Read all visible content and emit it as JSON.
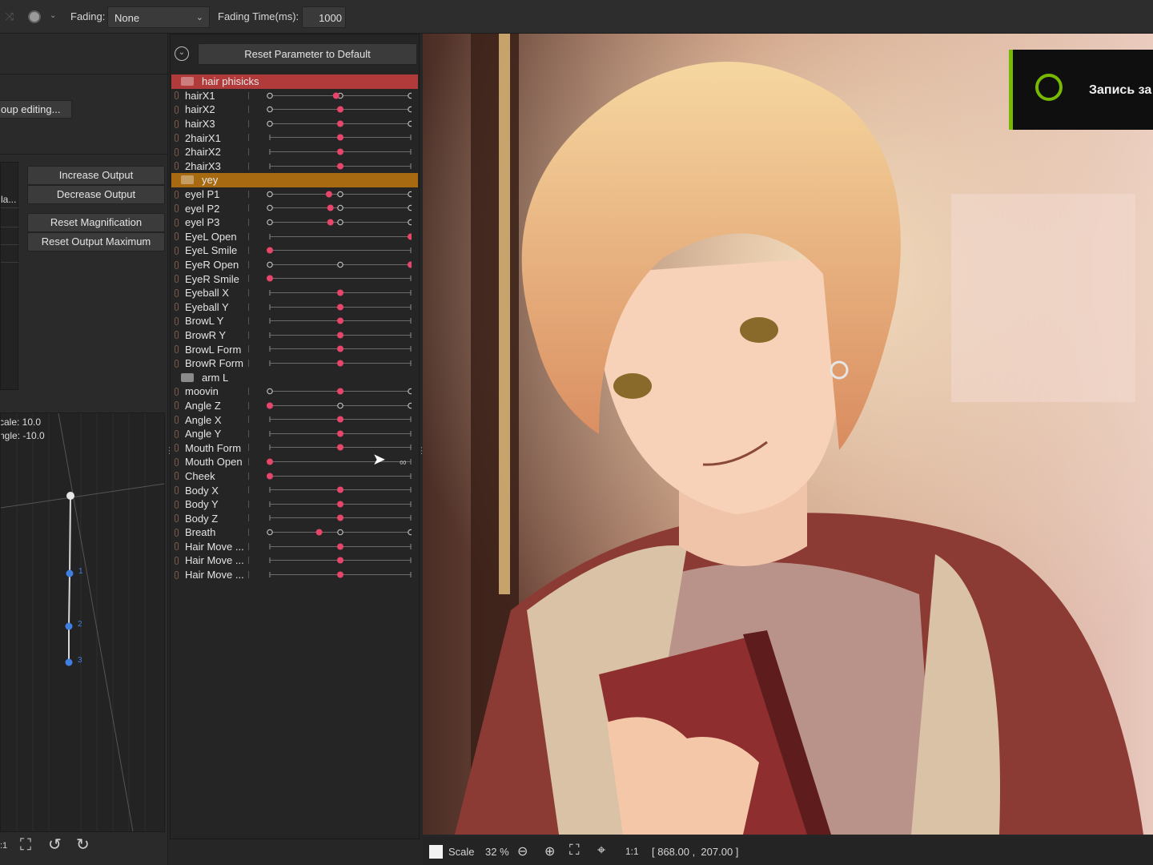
{
  "toolbar": {
    "fading_label": "Fading:",
    "fading_value": "None",
    "fading_time_label": "Fading Time(ms):",
    "fading_time_value": "1000"
  },
  "left_panel": {
    "group_editing": "oup editing...",
    "increase_output": "Increase Output",
    "decrease_output": "Decrease Output",
    "reset_magnification": "Reset Magnification",
    "reset_output_maximum": "Reset Output Maximum",
    "truncated_label": "la...",
    "scale_text": "cale: 10.0",
    "angle_text": "ngle: -10.0",
    "point_labels": [
      "1",
      "2",
      "3"
    ],
    "zoom_label": ":1"
  },
  "param_panel": {
    "reset_button": "Reset Parameter to Default",
    "entries": [
      {
        "type": "group",
        "name": "hair phisicks",
        "color": "#b13a3a"
      },
      {
        "type": "param",
        "name": "hairX1",
        "kind": "three",
        "value": 0.47
      },
      {
        "type": "param",
        "name": "hairX2",
        "kind": "three",
        "value": 0.5
      },
      {
        "type": "param",
        "name": "hairX3",
        "kind": "three",
        "value": 0.5
      },
      {
        "type": "param",
        "name": "2hairX1",
        "kind": "two",
        "value": 0.5
      },
      {
        "type": "param",
        "name": "2hairX2",
        "kind": "two",
        "value": 0.5
      },
      {
        "type": "param",
        "name": "2hairX3",
        "kind": "two",
        "value": 0.5
      },
      {
        "type": "group",
        "name": "yey",
        "color": "#a86a10"
      },
      {
        "type": "param",
        "name": "eyel P1",
        "kind": "three",
        "value": 0.42
      },
      {
        "type": "param",
        "name": "eyel P2",
        "kind": "three",
        "value": 0.43
      },
      {
        "type": "param",
        "name": "eyel P3",
        "kind": "three",
        "value": 0.43
      },
      {
        "type": "param",
        "name": "EyeL Open",
        "kind": "two",
        "value": 1.0
      },
      {
        "type": "param",
        "name": "EyeL Smile",
        "kind": "two",
        "value": 0.0
      },
      {
        "type": "param",
        "name": "EyeR Open",
        "kind": "three",
        "value": 1.0
      },
      {
        "type": "param",
        "name": "EyeR Smile",
        "kind": "two",
        "value": 0.0
      },
      {
        "type": "param",
        "name": "Eyeball X",
        "kind": "two",
        "value": 0.5
      },
      {
        "type": "param",
        "name": "Eyeball Y",
        "kind": "two",
        "value": 0.5
      },
      {
        "type": "param",
        "name": "BrowL Y",
        "kind": "two",
        "value": 0.5
      },
      {
        "type": "param",
        "name": "BrowR Y",
        "kind": "two",
        "value": 0.5
      },
      {
        "type": "param",
        "name": "BrowL Form",
        "kind": "two",
        "value": 0.5
      },
      {
        "type": "param",
        "name": "BrowR Form",
        "kind": "two",
        "value": 0.5
      },
      {
        "type": "group",
        "name": "arm L",
        "color": "#252525"
      },
      {
        "type": "param",
        "name": "moovin",
        "kind": "three",
        "value": 0.5
      },
      {
        "type": "param",
        "name": "Angle Z",
        "kind": "three",
        "value": 0.0
      },
      {
        "type": "param",
        "name": "Angle X",
        "kind": "two",
        "value": 0.5
      },
      {
        "type": "param",
        "name": "Angle Y",
        "kind": "two",
        "value": 0.5
      },
      {
        "type": "param",
        "name": "Mouth Form",
        "kind": "two",
        "value": 0.5
      },
      {
        "type": "param",
        "name": "Mouth Open",
        "kind": "loop",
        "value": 0.0
      },
      {
        "type": "param",
        "name": "Cheek",
        "kind": "two",
        "value": 0.0
      },
      {
        "type": "param",
        "name": "Body X",
        "kind": "two",
        "value": 0.5
      },
      {
        "type": "param",
        "name": "Body Y",
        "kind": "two",
        "value": 0.5
      },
      {
        "type": "param",
        "name": "Body Z",
        "kind": "two",
        "value": 0.5
      },
      {
        "type": "param",
        "name": "Breath",
        "kind": "three",
        "value": 0.35
      },
      {
        "type": "param",
        "name": "Hair Move ...",
        "kind": "two",
        "value": 0.5
      },
      {
        "type": "param",
        "name": "Hair Move ...",
        "kind": "two",
        "value": 0.5
      },
      {
        "type": "param",
        "name": "Hair Move ...",
        "kind": "two",
        "value": 0.5
      }
    ]
  },
  "overlay": {
    "recording_text": "Запись за"
  },
  "status": {
    "scale_label": "Scale",
    "scale_value": "32 %",
    "ratio": "1:1",
    "coords": "[ 868.00 ,  207.00 ]"
  },
  "colors": {
    "accent_knob": "#e8456a",
    "group_hair": "#b13a3a",
    "group_eye": "#a86a10",
    "nvidia_green": "#76b900"
  }
}
